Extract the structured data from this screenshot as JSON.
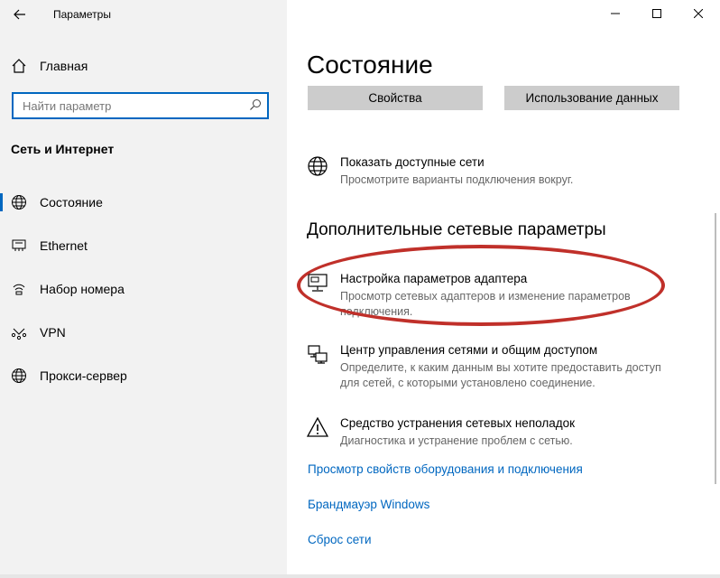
{
  "window": {
    "title": "Параметры"
  },
  "sidebar": {
    "home_label": "Главная",
    "search_placeholder": "Найти параметр",
    "section_title": "Сеть и Интернет",
    "items": [
      {
        "label": "Состояние",
        "icon": "globe-icon",
        "active": true
      },
      {
        "label": "Ethernet",
        "icon": "ethernet-icon"
      },
      {
        "label": "Набор номера",
        "icon": "dialup-icon"
      },
      {
        "label": "VPN",
        "icon": "vpn-icon"
      },
      {
        "label": "Прокси-сервер",
        "icon": "globe-icon"
      }
    ]
  },
  "main": {
    "title": "Состояние",
    "buttons": {
      "properties": "Свойства",
      "data_usage": "Использование данных"
    },
    "show_networks": {
      "title": "Показать доступные сети",
      "description": "Просмотрите варианты подключения вокруг."
    },
    "advanced_title": "Дополнительные сетевые параметры",
    "adapter": {
      "title": "Настройка параметров адаптера",
      "description": "Просмотр сетевых адаптеров и изменение параметров подключения."
    },
    "sharing_center": {
      "title": "Центр управления сетями и общим доступом",
      "description": "Определите, к каким данным вы хотите предоставить доступ для сетей, с которыми установлено соединение."
    },
    "troubleshooter": {
      "title": "Средство устранения сетевых неполадок",
      "description": "Диагностика и устранение проблем с сетью."
    },
    "links": {
      "hardware": "Просмотр свойств оборудования и подключения",
      "firewall": "Брандмауэр Windows",
      "reset": "Сброс сети"
    }
  },
  "colors": {
    "accent": "#0067c0",
    "annotation": "#c0302a",
    "sidebar_bg": "#f2f2f2",
    "button_bg": "#cccccc"
  }
}
